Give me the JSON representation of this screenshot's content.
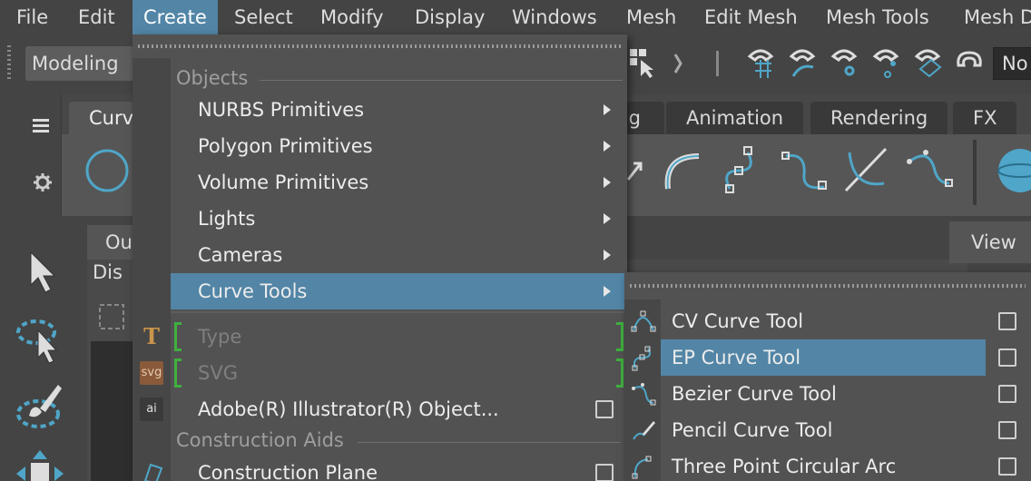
{
  "menubar": {
    "items": [
      "File",
      "Edit",
      "Create",
      "Select",
      "Modify",
      "Display",
      "Windows",
      "Mesh",
      "Edit Mesh",
      "Mesh Tools",
      "Mesh D"
    ],
    "active": "Create"
  },
  "toolbar": {
    "mode": "Modeling",
    "no_field": "No"
  },
  "shelf": {
    "tabs": [
      "Curv",
      "g",
      "Animation",
      "Rendering",
      "FX"
    ],
    "icons": [
      "circle-icon",
      "arc-icon",
      "ep-curve-icon",
      "cv-curve-icon",
      "bezier-icon",
      "pencil-curve-icon",
      "polygon-sphere-icon"
    ]
  },
  "panels": {
    "outliner_tab": "Ou",
    "display_tab": "Dis",
    "view_tab": "View"
  },
  "create_menu": {
    "section_objects": "Objects",
    "items": [
      {
        "label": "NURBS Primitives",
        "submenu": true
      },
      {
        "label": "Polygon Primitives",
        "submenu": true
      },
      {
        "label": "Volume Primitives",
        "submenu": true
      },
      {
        "label": "Lights",
        "submenu": true
      },
      {
        "label": "Cameras",
        "submenu": true
      },
      {
        "label": "Curve Tools",
        "submenu": true,
        "highlighted": true
      }
    ],
    "type_label": "Type",
    "svg_label": "SVG",
    "svg_icon_text": "svg",
    "illustrator_label": "Adobe(R) Illustrator(R) Object...",
    "ai_icon_text": "ai",
    "type_icon_text": "T",
    "section_construction": "Construction Aids",
    "construction_plane": "Construction Plane"
  },
  "curve_tools_submenu": {
    "items": [
      {
        "label": "CV Curve Tool",
        "icon": "cv-curve-icon"
      },
      {
        "label": "EP Curve Tool",
        "icon": "ep-curve-icon",
        "highlighted": true
      },
      {
        "label": "Bezier Curve Tool",
        "icon": "bezier-curve-icon"
      },
      {
        "label": "Pencil Curve Tool",
        "icon": "pencil-curve-icon"
      },
      {
        "label": "Three Point Circular Arc",
        "icon": "three-point-arc-icon"
      }
    ]
  },
  "colors": {
    "highlight": "#5285a6",
    "accent_icon": "#4fa6c8",
    "bracket_green": "#3fb03f"
  }
}
